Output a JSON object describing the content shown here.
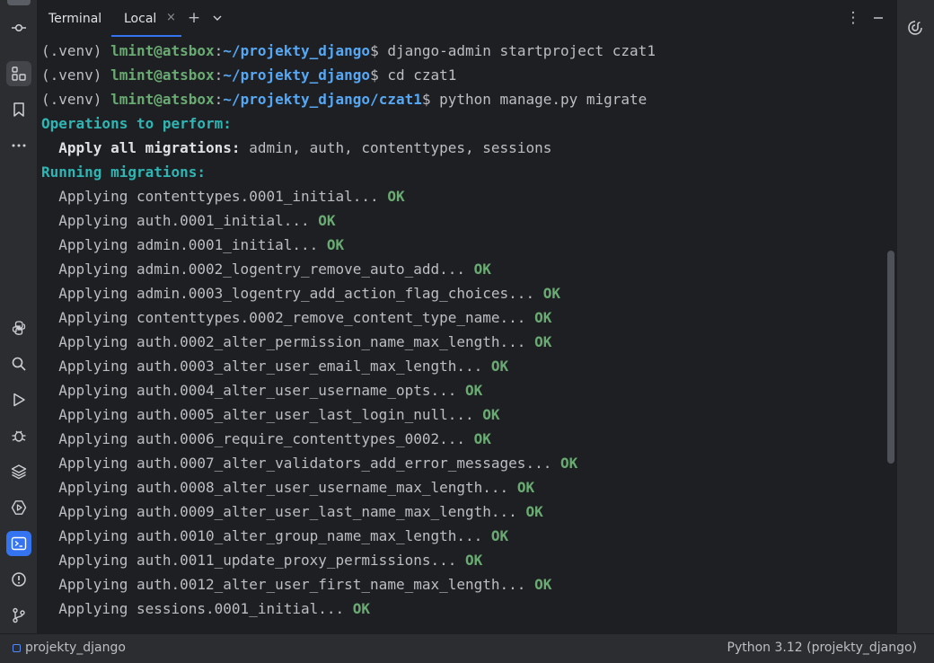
{
  "tool_window": {
    "title": "Terminal",
    "tab_label": "Local",
    "tab_close_glyph": "×",
    "new_tab_glyph": "+",
    "dropdown_glyph": "⌄",
    "more_glyph": "⋮",
    "minimize_glyph": "—"
  },
  "left_toolbar": [
    "commit-icon",
    "project-icon",
    "bookmarks-icon",
    "more-icon",
    "python-console-icon",
    "search-icon",
    "run-icon",
    "debug-icon",
    "layers-icon",
    "services-icon",
    "terminal-icon",
    "problems-icon",
    "git-icon"
  ],
  "right_toolbar": [
    "ai-assistant-icon"
  ],
  "terminal": {
    "prompts": [
      {
        "venv": "(.venv) ",
        "user": "lmint@atsbox",
        "colon": ":",
        "path": "~/projekty_django",
        "dollar": "$ ",
        "command": "django-admin startproject czat1"
      },
      {
        "venv": "(.venv) ",
        "user": "lmint@atsbox",
        "colon": ":",
        "path": "~/projekty_django",
        "dollar": "$ ",
        "command": "cd czat1"
      },
      {
        "venv": "(.venv) ",
        "user": "lmint@atsbox",
        "colon": ":",
        "path": "~/projekty_django/czat1",
        "dollar": "$ ",
        "command": "python manage.py migrate"
      }
    ],
    "operations_header": "Operations to perform:",
    "apply_all_label": "  Apply all migrations:",
    "apply_all_value": " admin, auth, contenttypes, sessions",
    "running_header": "Running migrations:",
    "ok_text": "OK",
    "migrations": [
      "  Applying contenttypes.0001_initial... ",
      "  Applying auth.0001_initial... ",
      "  Applying admin.0001_initial... ",
      "  Applying admin.0002_logentry_remove_auto_add... ",
      "  Applying admin.0003_logentry_add_action_flag_choices... ",
      "  Applying contenttypes.0002_remove_content_type_name... ",
      "  Applying auth.0002_alter_permission_name_max_length... ",
      "  Applying auth.0003_alter_user_email_max_length... ",
      "  Applying auth.0004_alter_user_username_opts... ",
      "  Applying auth.0005_alter_user_last_login_null... ",
      "  Applying auth.0006_require_contenttypes_0002... ",
      "  Applying auth.0007_alter_validators_add_error_messages... ",
      "  Applying auth.0008_alter_user_username_max_length... ",
      "  Applying auth.0009_alter_user_last_name_max_length... ",
      "  Applying auth.0010_alter_group_name_max_length... ",
      "  Applying auth.0011_update_proxy_permissions... ",
      "  Applying auth.0012_alter_user_first_name_max_length... ",
      "  Applying sessions.0001_initial... "
    ]
  },
  "status_bar": {
    "project": "projekty_django",
    "interpreter": "Python 3.12 (projekty_django)"
  },
  "colors": {
    "background": "#1e1f22",
    "chrome": "#2b2d30",
    "user_host": "#6aab73",
    "path": "#56a8f5",
    "header": "#2fb5b3",
    "ok": "#6aab73",
    "accent": "#3574f0"
  }
}
